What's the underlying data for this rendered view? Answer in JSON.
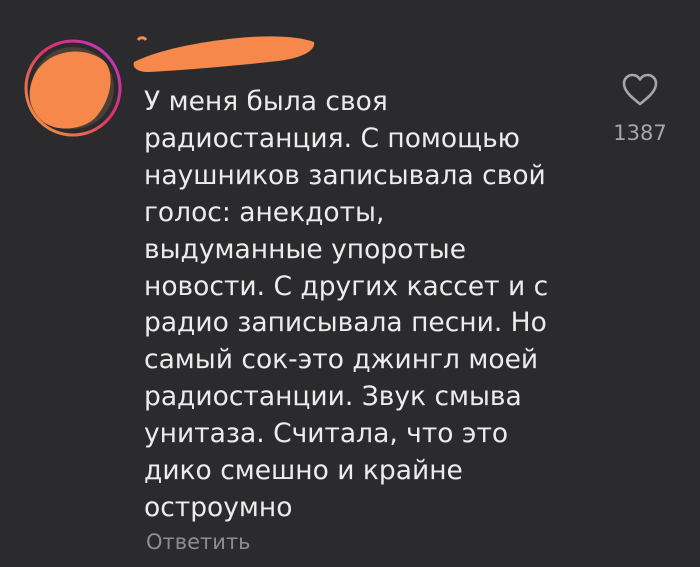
{
  "comment": {
    "text": "У меня была своя\nрадиостанция. С помощью\nнаушников записывала свой\nголос: анекдоты,\nвыдуманные упоротые\nновости. С других кассет и с\nрадио записывала песни. Но\nсамый сок-это джингл моей\nрадиостанции. Звук смыва\nунитаза. Считала, что это\nдико смешно и крайне\nостроумно",
    "reply_label": "Ответить",
    "like_count": "1387"
  },
  "icons": {
    "avatar": "avatar-redacted",
    "like": "heart-outline-icon"
  },
  "colors": {
    "background": "#2b2b2d",
    "text": "#ececec",
    "secondary_text": "#8d8d90",
    "redaction": "#f5884a",
    "story_ring_start": "#f2a43a",
    "story_ring_end": "#b43ad6"
  }
}
